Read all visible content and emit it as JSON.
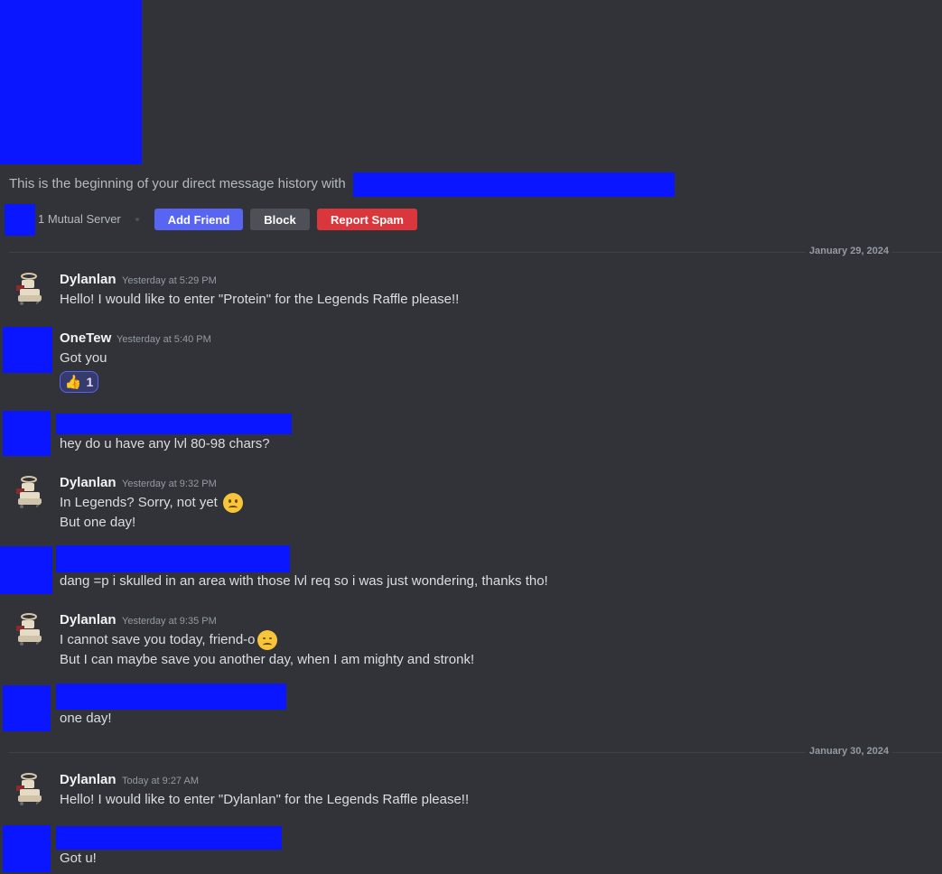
{
  "header": {
    "intro_text": "This is the beginning of your direct message history with",
    "mutual_servers": "1 Mutual Server",
    "add_friend": "Add Friend",
    "block": "Block",
    "report_spam": "Report Spam"
  },
  "dividers": [
    {
      "date": "January 29, 2024"
    },
    {
      "date": "January 30, 2024"
    }
  ],
  "messages": [
    {
      "author": "Dylanlan",
      "time": "Yesterday at 5:29 PM",
      "lines": [
        "Hello! I would like to enter \"Protein\" for the Legends Raffle please!!"
      ]
    },
    {
      "author": "OneTew",
      "time": "Yesterday at 5:40 PM",
      "lines": [
        "Got you"
      ],
      "reaction": {
        "emoji": "👍",
        "count": "1"
      }
    },
    {
      "author": "",
      "time": "",
      "lines": [
        "hey do u have any lvl 80-98 chars?"
      ]
    },
    {
      "author": "Dylanlan",
      "time": "Yesterday at 9:32 PM",
      "lines": [
        "In Legends? Sorry, not yet",
        "But one day!"
      ],
      "emoji": "slightly-frowning-face"
    },
    {
      "author": "",
      "time": "",
      "lines": [
        "dang =p i skulled in an area with those lvl req so i was just wondering, thanks tho!"
      ]
    },
    {
      "author": "Dylanlan",
      "time": "Yesterday at 9:35 PM",
      "lines": [
        "I cannot save you today, friend-o",
        "But I can maybe save you another day, when I am mighty and stronk!"
      ],
      "emoji": "disappointed-face"
    },
    {
      "author": "",
      "time": "",
      "lines": [
        "one day!"
      ]
    },
    {
      "author": "Dylanlan",
      "time": "Today at 9:27 AM",
      "lines": [
        "Hello! I would like to enter \"Dylanlan\" for the Legends Raffle please!!"
      ]
    },
    {
      "author": "",
      "time": "",
      "lines": [
        "Got u!"
      ]
    }
  ],
  "colors": {
    "background": "#313338",
    "redaction": "#0a16ff",
    "add_friend": "#5865f2",
    "block": "#4e5058",
    "report_spam": "#da373c"
  }
}
